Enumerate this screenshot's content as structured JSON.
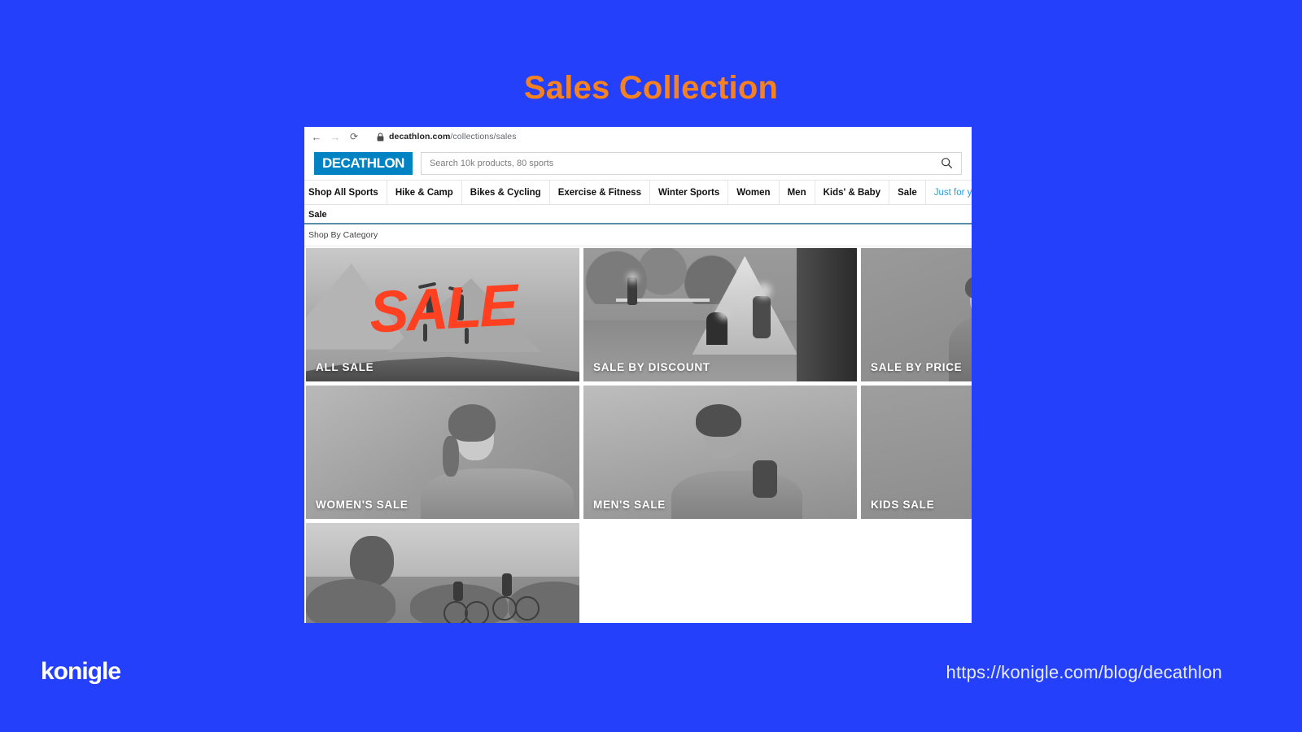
{
  "slide": {
    "title": "Sales Collection",
    "title_color": "#f58220",
    "background_color": "#2440fb",
    "brand_logo": "konigle",
    "footer_url": "https://konigle.com/blog/decathlon"
  },
  "browser": {
    "back_icon": "back-arrow-icon",
    "forward_icon": "forward-arrow-icon",
    "reload_icon": "reload-icon",
    "lock_icon": "lock-icon",
    "url_host": "decathlon.com",
    "url_path": "/collections/sales",
    "url_full": "decathlon.com/collections/sales"
  },
  "site": {
    "logo_text": "DECATHLON",
    "logo_color": "#0082c3",
    "search": {
      "placeholder": "Search 10k products, 80 sports",
      "value": "",
      "icon": "search-icon"
    },
    "nav": [
      {
        "label": "Shop All Sports",
        "accent": false
      },
      {
        "label": "Hike & Camp",
        "accent": false
      },
      {
        "label": "Bikes & Cycling",
        "accent": false
      },
      {
        "label": "Exercise & Fitness",
        "accent": false
      },
      {
        "label": "Winter Sports",
        "accent": false
      },
      {
        "label": "Women",
        "accent": false
      },
      {
        "label": "Men",
        "accent": false
      },
      {
        "label": "Kids' & Baby",
        "accent": false
      },
      {
        "label": "Sale",
        "accent": false
      },
      {
        "label": "Just for you",
        "accent": true
      }
    ],
    "page_title": "Sale",
    "section_title": "Shop By Category",
    "accent_link_color": "#2e9bd6"
  },
  "tiles": [
    {
      "label": "ALL SALE",
      "overlay_text": "SALE",
      "overlay_color": "#ff4122",
      "scene": "mountain-hikers"
    },
    {
      "label": "SALE BY DISCOUNT",
      "overlay_text": "",
      "overlay_color": "",
      "scene": "campsite-friends"
    },
    {
      "label": "SALE BY PRICE",
      "overlay_text": "",
      "overlay_color": "",
      "scene": "person-outdoors"
    },
    {
      "label": "WOMEN'S SALE",
      "overlay_text": "",
      "overlay_color": "",
      "scene": "woman-smiling"
    },
    {
      "label": "MEN'S SALE",
      "overlay_text": "",
      "overlay_color": "",
      "scene": "man-backpack"
    },
    {
      "label": "KIDS SALE",
      "overlay_text": "",
      "overlay_color": "",
      "scene": "child-laughing"
    },
    {
      "label": "",
      "overlay_text": "",
      "overlay_color": "",
      "scene": "cyclists-road"
    }
  ]
}
